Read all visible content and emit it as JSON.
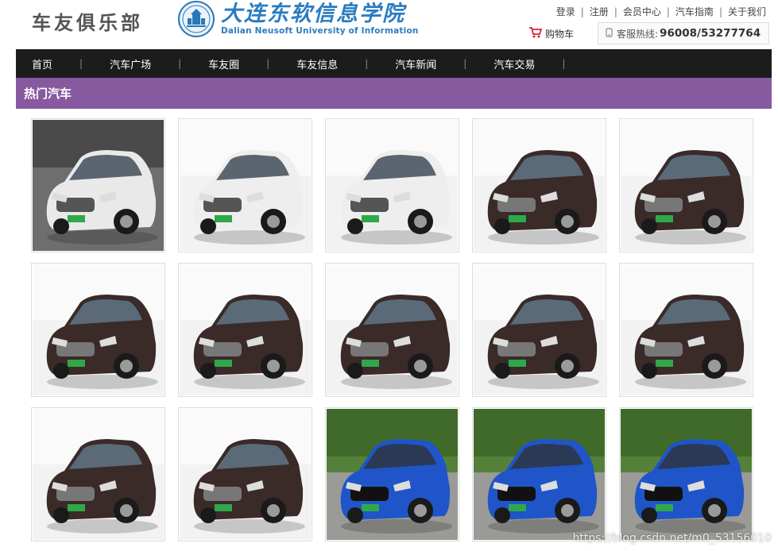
{
  "header": {
    "site_title": "车友俱乐部",
    "logo_cn": "大连东软信息学院",
    "logo_en": "Dalian Neusoft University of Information",
    "top_links": [
      "登录",
      "注册",
      "会员中心",
      "汽车指南",
      "关于我们"
    ],
    "cart_label": "购物车",
    "hotline_label": "客服热线:",
    "hotline_number": "96008/53277764"
  },
  "nav": {
    "items": [
      "首页",
      "汽车广场",
      "车友圈",
      "车友信息",
      "汽车新闻",
      "汽车交易"
    ]
  },
  "section": {
    "title": "热门汽车"
  },
  "cars": [
    {
      "kind": "sedan",
      "color": "#e9e9e9"
    },
    {
      "kind": "suv",
      "color": "#eeeeee"
    },
    {
      "kind": "suv",
      "color": "#eeeeee"
    },
    {
      "kind": "hatch",
      "color": "#3a2a28"
    },
    {
      "kind": "hatch",
      "color": "#3a2a28"
    },
    {
      "kind": "hatch",
      "color": "#3a2a28"
    },
    {
      "kind": "hatch",
      "color": "#3a2a28"
    },
    {
      "kind": "hatch",
      "color": "#3a2a28"
    },
    {
      "kind": "hatch",
      "color": "#3a2a28"
    },
    {
      "kind": "hatch",
      "color": "#3a2a28"
    },
    {
      "kind": "hatch",
      "color": "#3a2a28"
    },
    {
      "kind": "hatch",
      "color": "#3a2a28"
    },
    {
      "kind": "fiesta",
      "color": "#1f55c8"
    },
    {
      "kind": "fiesta",
      "color": "#1f55c8"
    },
    {
      "kind": "fiesta",
      "color": "#1f55c8"
    }
  ],
  "watermark": "https://blog.csdn.net/m0_53156010",
  "colors": {
    "nav_bg": "#1c1c1c",
    "section_bg": "#875a9f",
    "logo_blue": "#2b7cc0",
    "cart_red": "#d9233b"
  },
  "icons": {
    "cart": "shopping-cart-icon",
    "hotline": "phone-icon",
    "logo": "university-seal-icon"
  }
}
